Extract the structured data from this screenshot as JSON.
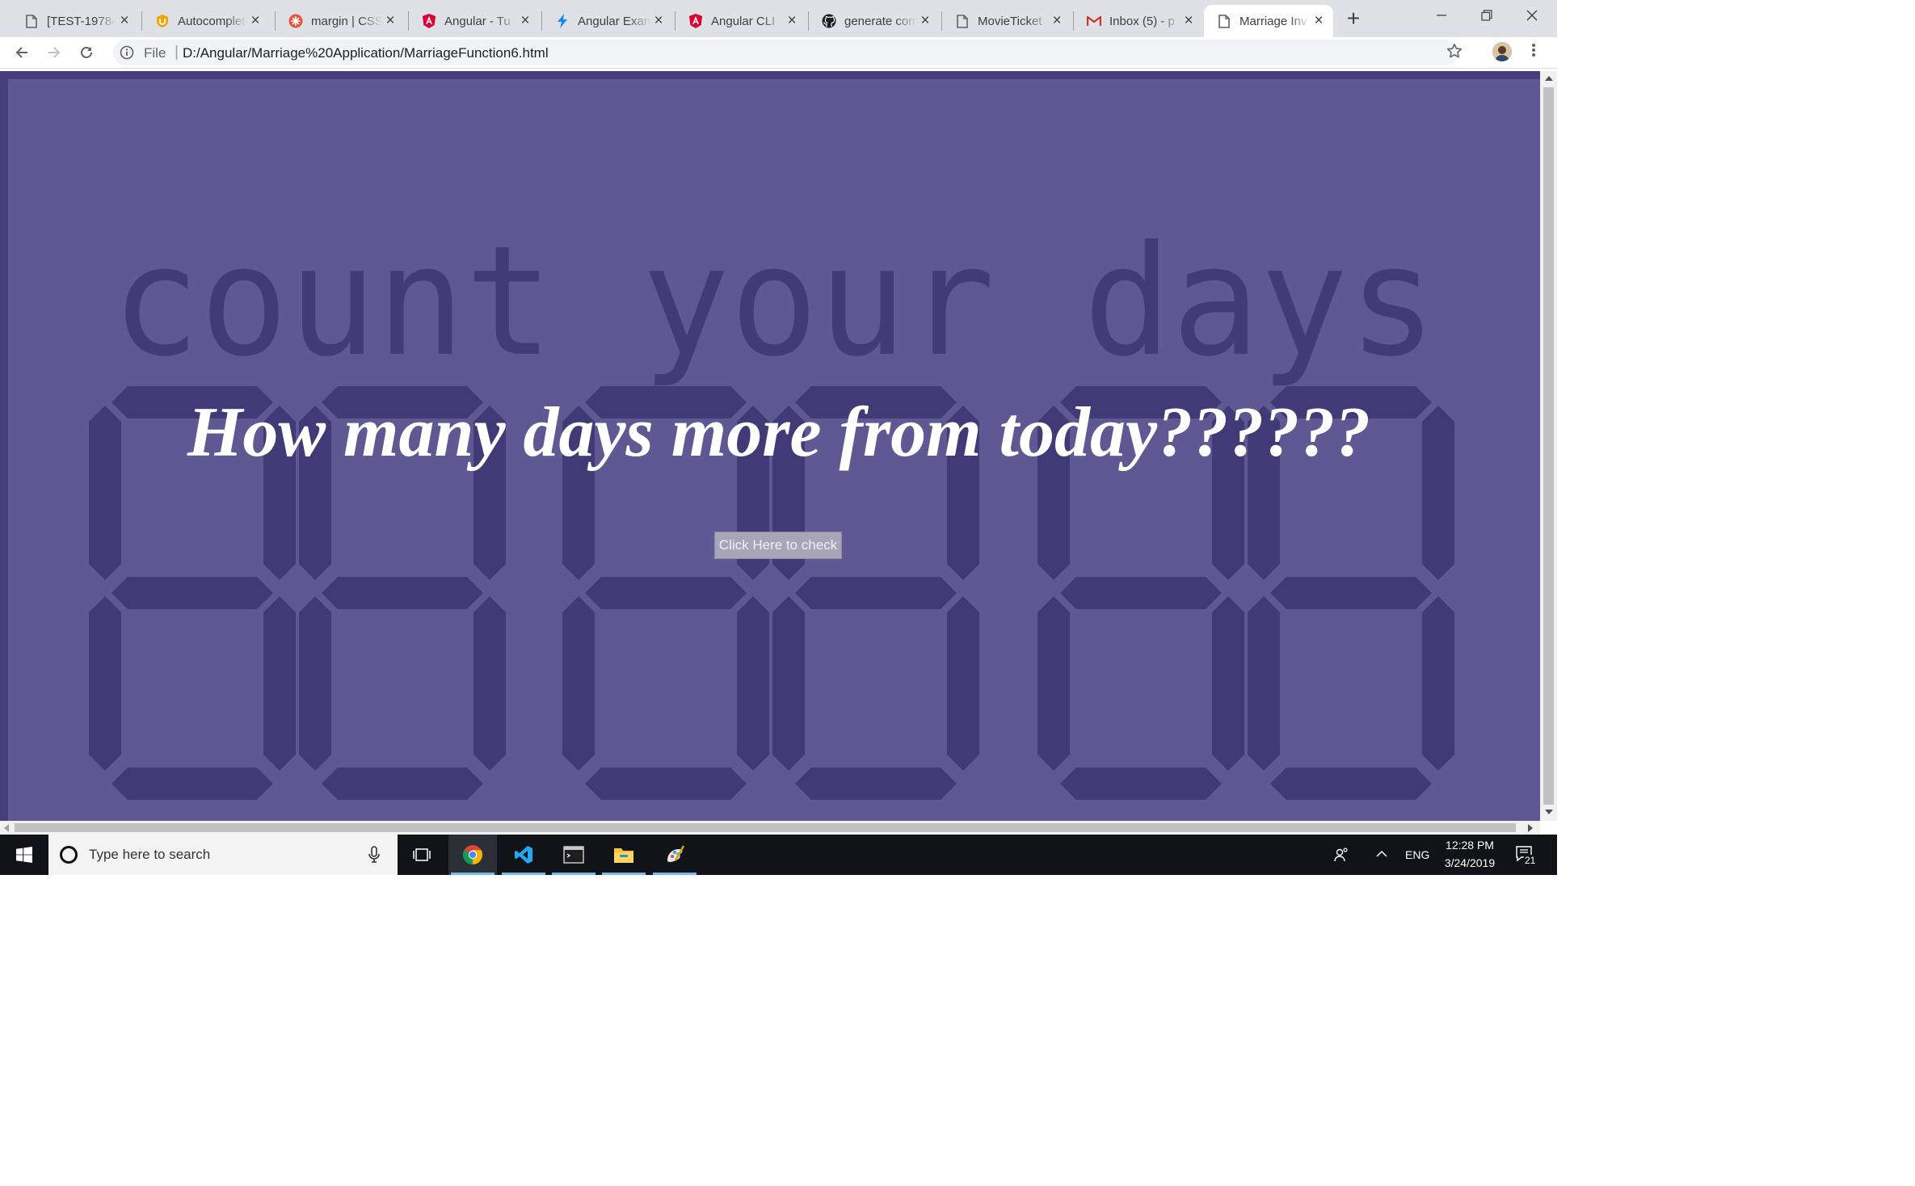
{
  "browser": {
    "tabs": [
      {
        "title": "[TEST-19784]",
        "icon": "document-icon",
        "active": false
      },
      {
        "title": "Autocomplete",
        "icon": "shield-icon",
        "active": false
      },
      {
        "title": "margin | CSS",
        "icon": "css-tricks-icon",
        "active": false
      },
      {
        "title": "Angular - Tu",
        "icon": "angular-icon",
        "active": false
      },
      {
        "title": "Angular Exam",
        "icon": "stackblitz-icon",
        "active": false
      },
      {
        "title": "Angular CLI",
        "icon": "angular-icon",
        "active": false
      },
      {
        "title": "generate com",
        "icon": "github-icon",
        "active": false
      },
      {
        "title": "MovieTicket",
        "icon": "document-icon",
        "active": false
      },
      {
        "title": "Inbox (5) - p",
        "icon": "gmail-icon",
        "active": false
      },
      {
        "title": "Marriage Inv",
        "icon": "document-icon",
        "active": true
      }
    ],
    "address": {
      "scheme_label": "File",
      "url": "D:/Angular/Marriage%20Application/MarriageFunction6.html"
    }
  },
  "page": {
    "headline": "How many days more from today??????",
    "check_button": "Click Here to check",
    "background_text": "count your days",
    "colors": {
      "page_bg": "#5e5893",
      "frame_bg": "#463f7c",
      "art": "#3d3873",
      "button_bg": "#a7a5b7"
    }
  },
  "taskbar": {
    "search_placeholder": "Type here to search",
    "language": "ENG",
    "time": "12:28 PM",
    "date": "3/24/2019",
    "notification_count": "21"
  }
}
